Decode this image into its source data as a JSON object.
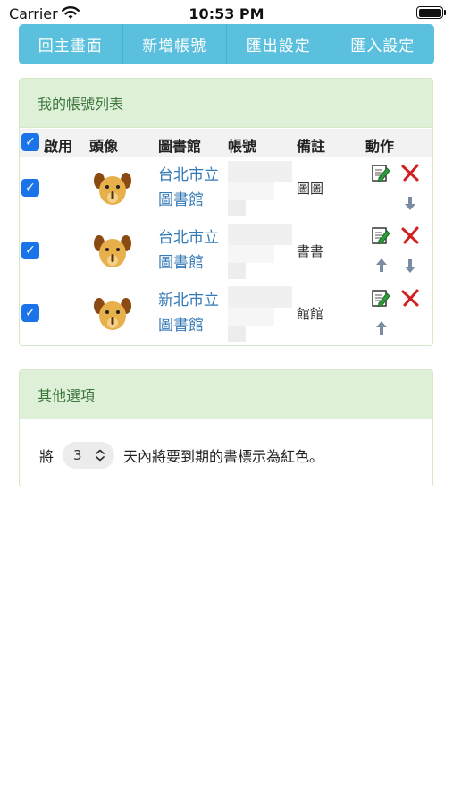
{
  "status_bar": {
    "carrier": "Carrier",
    "time": "10:53 PM"
  },
  "toolbar": {
    "buttons": [
      "回主畫面",
      "新增帳號",
      "匯出設定",
      "匯入設定"
    ]
  },
  "accounts_panel": {
    "title": "我的帳號列表",
    "columns": [
      "啟用",
      "頭像",
      "圖書館",
      "帳號",
      "備註",
      "動作"
    ],
    "rows": [
      {
        "enabled": true,
        "library_line1": "台北市立",
        "library_line2": "圖書館",
        "note": "圖圖"
      },
      {
        "enabled": true,
        "library_line1": "台北市立",
        "library_line2": "圖書館",
        "note": "書書"
      },
      {
        "enabled": true,
        "library_line1": "新北市立",
        "library_line2": "圖書館",
        "note": "館館"
      }
    ]
  },
  "options_panel": {
    "title": "其他選項",
    "prefix": "將",
    "days_value": "3",
    "suffix": "天內將要到期的書標示為紅色。"
  }
}
